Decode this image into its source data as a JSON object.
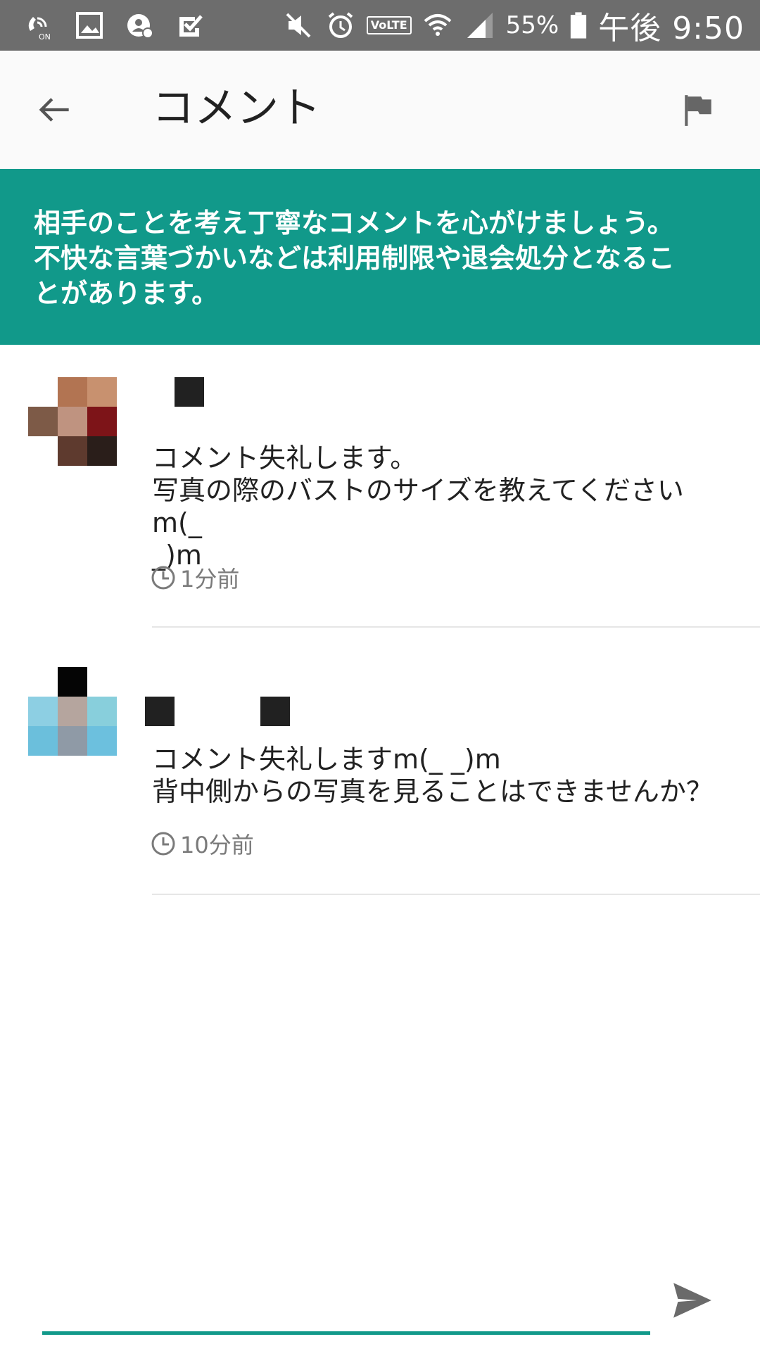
{
  "status_bar": {
    "battery_percent": "55%",
    "time": "午後 9:50",
    "volte_label": "VoLTE",
    "wifi_calling_label": "ON",
    "icons": [
      "wifi-calling-icon",
      "gallery-icon",
      "user-sync-icon",
      "check-task-icon",
      "mute-icon",
      "alarm-icon",
      "volte-icon",
      "wifi-icon",
      "signal-icon",
      "battery-icon"
    ]
  },
  "toolbar": {
    "title": "コメント",
    "back_icon": "arrow-back-icon",
    "flag_icon": "flag-icon"
  },
  "banner": {
    "lines": [
      "相手のことを考え丁寧なコメントを心がけましょう。",
      "不快な言葉づかいなどは利用制限や退会処分となるこ",
      "とがあります。"
    ]
  },
  "comments": [
    {
      "text_lines": [
        "コメント失礼します。",
        "写真の際のバストのサイズを教えてくださいm(_",
        "_)m"
      ],
      "time": "1分前"
    },
    {
      "text_lines": [
        "コメント失礼しますm(_ _)m",
        "背中側からの写真を見ることはできませんか？"
      ],
      "time": "10分前"
    }
  ],
  "input": {
    "placeholder": "",
    "send_icon": "send-icon"
  },
  "colors": {
    "status_bar": "#6d6d6d",
    "toolbar": "#fafafa",
    "accent": "#11998a"
  }
}
